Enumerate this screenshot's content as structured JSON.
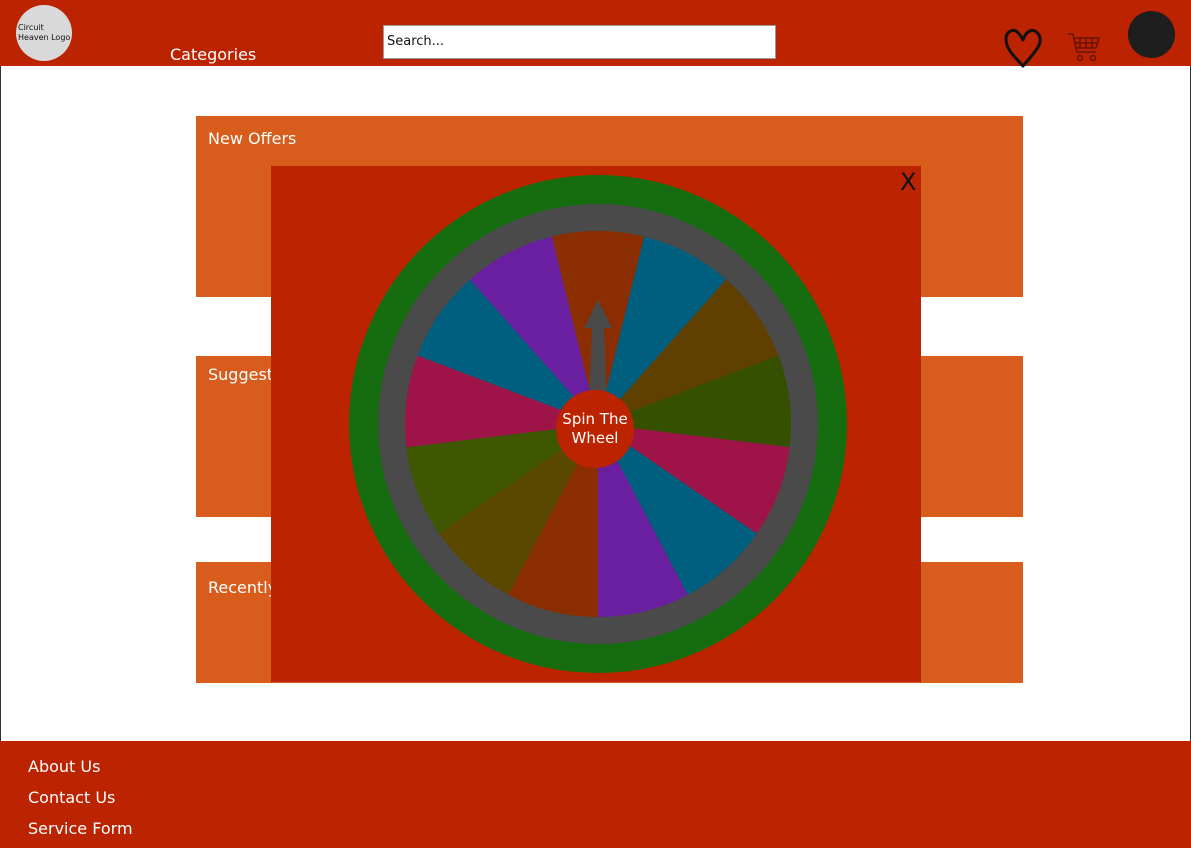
{
  "header": {
    "logo_text": "Circuit Heaven Logo",
    "categories_label": "Categories",
    "search_placeholder": "Search..."
  },
  "sections": [
    {
      "title": "New Offers"
    },
    {
      "title": "Suggest"
    },
    {
      "title": "Recently"
    }
  ],
  "spin_modal": {
    "close_label": "X",
    "spin_label": "Spin The Wheel",
    "segment_colors": [
      "#8a2d00",
      "#005f7f",
      "#604000",
      "#355000",
      "#9e1448",
      "#005f7f",
      "#6a1fa0",
      "#8a2d00",
      "#5a4700",
      "#3e5700",
      "#9e1448",
      "#005f7f",
      "#6a1fa0"
    ]
  },
  "footer": {
    "links": [
      "About Us",
      "Contact Us",
      "Service Form"
    ]
  },
  "colors": {
    "header_bg": "#bc2300",
    "section_bg": "#d85c1b",
    "wheel_outer": "#166d0f",
    "wheel_rim": "#4a4a4a"
  }
}
